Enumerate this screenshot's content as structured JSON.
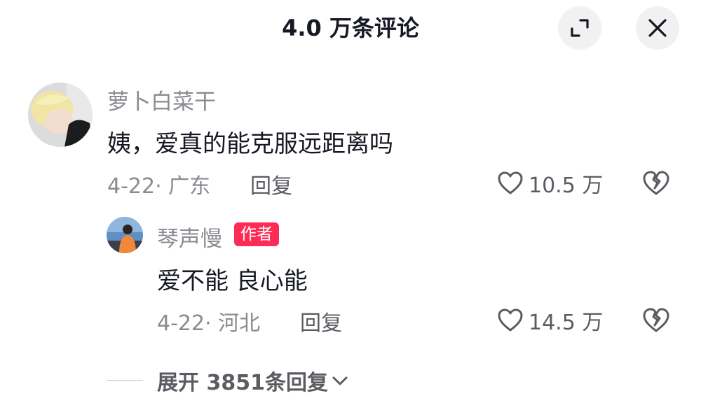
{
  "header": {
    "title": "4.0 万条评论",
    "expand_icon": "expand-icon",
    "close_icon": "close-icon"
  },
  "comments": [
    {
      "username": "萝卜白菜干",
      "avatar": "avatar-photo",
      "text": "姨，爱真的能克服远距离吗",
      "meta": "4-22· 广东",
      "reply_label": "回复",
      "likes": "10.5 万",
      "like_icon": "heart-outline-icon",
      "dislike_icon": "broken-heart-icon"
    }
  ],
  "replies": [
    {
      "username": "琴声慢",
      "badge": "作者",
      "avatar": "avatar-photo",
      "text": "爱不能 良心能",
      "meta": "4-22· 河北",
      "reply_label": "回复",
      "likes": "14.5 万",
      "like_icon": "heart-outline-icon",
      "dislike_icon": "broken-heart-icon"
    }
  ],
  "expand_replies": {
    "label": "展开 3851条回复",
    "icon": "chevron-down-icon"
  },
  "colors": {
    "text_primary": "#161823",
    "text_secondary": "#8a8b91",
    "author_badge": "#fe2c55",
    "button_bg": "#f1f1f2"
  }
}
